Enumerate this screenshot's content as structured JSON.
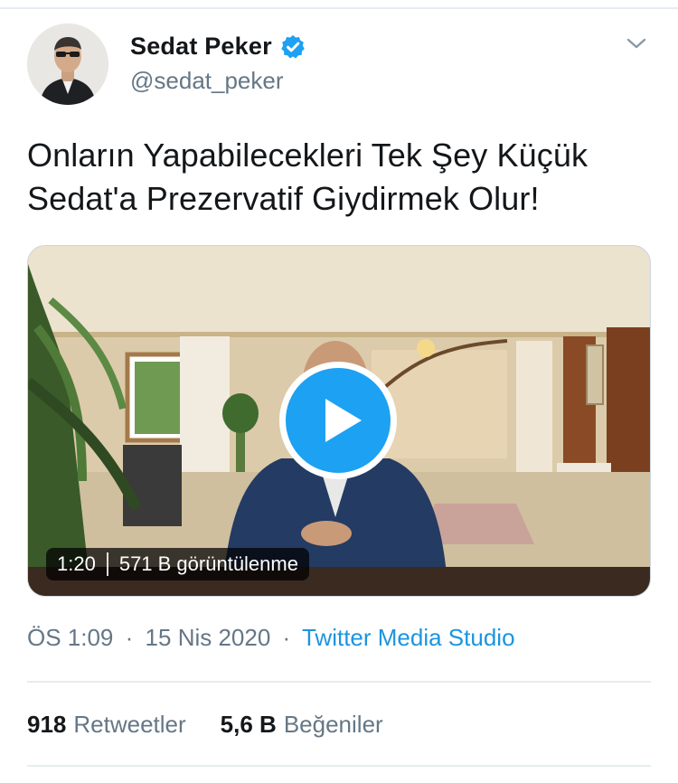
{
  "user": {
    "display_name": "Sedat Peker",
    "handle": "@sedat_peker",
    "verified_icon": "verified-badge-icon",
    "avatar_icon": "avatar"
  },
  "tweet": {
    "text": "Onların Yapabilecekleri Tek Şey Küçük Sedat'a Prezervatif Giydirmek Olur!",
    "media": {
      "duration": "1:20",
      "views": "571 B görüntülenme"
    },
    "time": "ÖS 1:09",
    "date": "15 Nis 2020",
    "separator": "·",
    "source": "Twitter Media Studio"
  },
  "stats": {
    "retweets_count": "918",
    "retweets_label": "Retweetler",
    "likes_count": "5,6 B",
    "likes_label": "Beğeniler"
  },
  "colors": {
    "accent": "#1da1f2",
    "link": "#1b95e0",
    "secondary_text": "#657786",
    "primary_text": "#14171a",
    "divider": "#e6ecf0"
  }
}
